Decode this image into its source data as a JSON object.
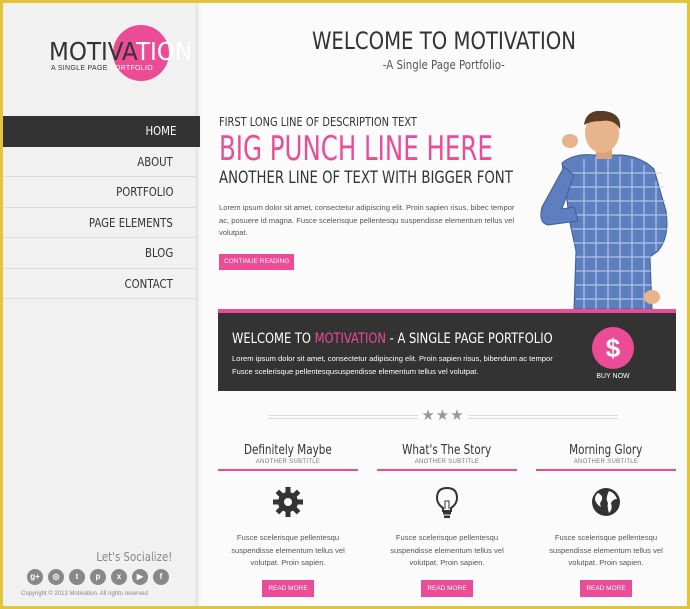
{
  "brand": {
    "name_a": "MOTIVA",
    "name_b": "TION",
    "tagline_a": "A SINGLE PAGE ",
    "tagline_b": "PORTFOLIO",
    "accent": "#ec4b96",
    "dark": "#333333"
  },
  "nav": {
    "items": [
      {
        "label": "HOME",
        "active": true
      },
      {
        "label": "ABOUT"
      },
      {
        "label": "PORTFOLIO"
      },
      {
        "label": "PAGE ELEMENTS"
      },
      {
        "label": "BLOG"
      },
      {
        "label": "CONTACT"
      }
    ]
  },
  "social": {
    "title": "Let's Socialize!",
    "icons": [
      "google-plus-icon",
      "dribbble-icon",
      "twitter-icon",
      "pinterest-icon",
      "xing-icon",
      "youtube-icon",
      "facebook-icon"
    ],
    "copyright": "Copyright © 2013 Motivation. All rights reserved"
  },
  "header": {
    "title": "WELCOME TO MOTIVATION",
    "subtitle": "-A Single Page Portfolio-"
  },
  "hero": {
    "line1": "FIRST LONG LINE OF DESCRIPTION TEXT",
    "punch": "BIG PUNCH LINE HERE",
    "line3": "ANOTHER LINE OF TEXT WITH BIGGER FONT",
    "body": "Lorem ipsum dolor sit amet, consectetur adipiscing elit. Proin sapien risus, bibec tempor ac, posuere id magna. Fusce scelerisque pellentesqu suspendisse elementum tellus vel volutpat.",
    "button": "CONTINUE READING"
  },
  "banner": {
    "title_a": "WELCOME TO ",
    "title_b": "MOTIVATION",
    "title_c": " - A SINGLE PAGE PORTFOLIO",
    "body": "Lorem ipsum dolor sit amet, consectetur adipiscing elit. Proin sapien risus, bibendum ac tempor Fusce scelerisque pellentesqususpendisse elementum tellus vel volutpat.",
    "buy_symbol": "$",
    "buy_label": "BUY NOW"
  },
  "columns": [
    {
      "title": "Definitely Maybe",
      "subtitle": "ANOTHER SUBTITLE",
      "icon": "gear-icon",
      "text": "Fusce scelerisque pellentesqu suspendisse elementum tellus vel volutpat. Proin sapien.",
      "button": "READ MORE"
    },
    {
      "title": "What's The Story",
      "subtitle": "ANOTHER SUBTITLE",
      "icon": "lightbulb-icon",
      "text": "Fusce scelerisque pellentesqu suspendisse elementum tellus vel volutpat. Proin sapien.",
      "button": "READ MORE"
    },
    {
      "title": "Morning Glory",
      "subtitle": "ANOTHER SUBTITLE",
      "icon": "globe-icon",
      "text": "Fusce scelerisque pellentesqu suspendisse elementum tellus vel volutpat. Proin sapien.",
      "button": "READ MORE"
    }
  ],
  "divider": {
    "stars": "★★★"
  }
}
